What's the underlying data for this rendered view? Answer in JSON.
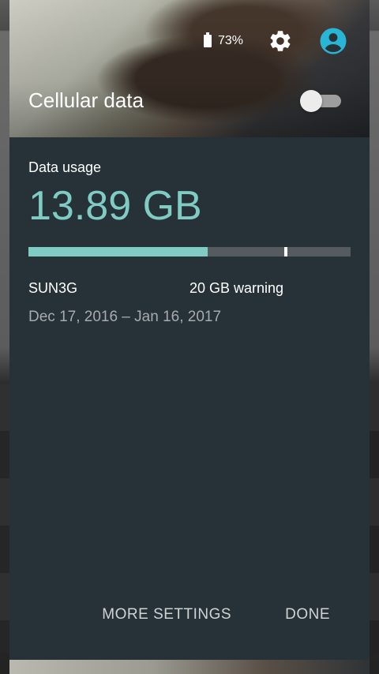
{
  "status": {
    "battery_percent": "73%",
    "battery_icon": "battery-icon",
    "settings_icon": "gear-icon",
    "account_icon": "account-circle-icon"
  },
  "panel": {
    "title": "Cellular data",
    "toggle_on": false
  },
  "data_usage": {
    "label": "Data usage",
    "amount": "13.89 GB",
    "usage_fraction": 0.5556,
    "warning_fraction": 0.8,
    "carrier": "SUN3G",
    "warning": "20 GB warning",
    "period": "Dec 17, 2016 – Jan 16, 2017"
  },
  "actions": {
    "more_settings": "MORE SETTINGS",
    "done": "DONE"
  },
  "colors": {
    "accent": "#80cbc4",
    "panel_bg": "#263238",
    "avatar": "#29b6d6"
  }
}
